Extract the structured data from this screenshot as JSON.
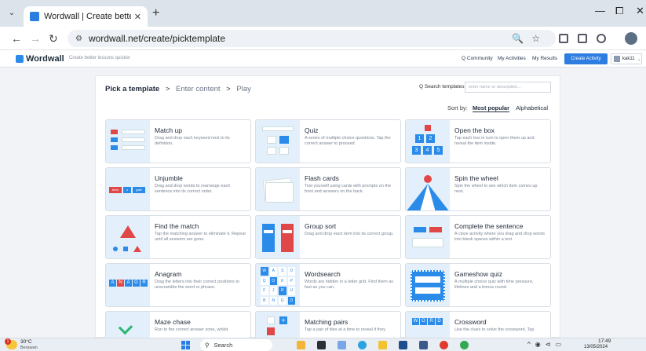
{
  "browser": {
    "tab_title": "Wordwall | Create better lessons quicker",
    "tab_close": "✕",
    "new_tab": "+",
    "url": "wordwall.net/create/picktemplate",
    "window_controls": [
      "—",
      "⧠",
      "✕"
    ]
  },
  "site": {
    "logo": "Wordwall",
    "tagline": "Create better lessons quicker",
    "nav": [
      "Community",
      "My Activities",
      "My Results"
    ],
    "create_button": "Create Activity",
    "user": "kak11"
  },
  "breadcrumb": {
    "step1": "Pick a template",
    "step2": "Enter content",
    "step3": "Play",
    "sep": ">"
  },
  "search": {
    "label": "Search templates:",
    "placeholder": "enter name or description..."
  },
  "sort": {
    "label": "Sort by:",
    "popular": "Most popular",
    "alphabetical": "Alphabetical"
  },
  "templates": [
    {
      "title": "Match up",
      "desc": "Drag and drop each keyword next to its definition."
    },
    {
      "title": "Quiz",
      "desc": "A series of multiple choice questions. Tap the correct answer to proceed."
    },
    {
      "title": "Open the box",
      "desc": "Tap each box in turn to open them up and reveal the item inside."
    },
    {
      "title": "Unjumble",
      "desc": "Drag and drop words to rearrange each sentence into its correct order."
    },
    {
      "title": "Flash cards",
      "desc": "Test yourself using cards with prompts on the front and answers on the back."
    },
    {
      "title": "Spin the wheel",
      "desc": "Spin the wheel to see which item comes up next."
    },
    {
      "title": "Find the match",
      "desc": "Tap the matching answer to eliminate it. Repeat until all answers are gone."
    },
    {
      "title": "Group sort",
      "desc": "Drag and drop each item into its correct group."
    },
    {
      "title": "Complete the sentence",
      "desc": "A cloze activity where you drag and drop words into blank spaces within a text."
    },
    {
      "title": "Anagram",
      "desc": "Drag the letters into their correct positions to unscramble the word or phrase."
    },
    {
      "title": "Wordsearch",
      "desc": "Words are hidden in a letter grid. Find them as fast as you can."
    },
    {
      "title": "Gameshow quiz",
      "desc": "A multiple choice quiz with time pressure, lifelines and a bonus round."
    },
    {
      "title": "Maze chase",
      "desc": "Run to the correct answer zone, whilst"
    },
    {
      "title": "Matching pairs",
      "desc": "Tap a pair of tiles at a time to reveal if they"
    },
    {
      "title": "Crossword",
      "desc": "Use the clues to solve the crossword. Tap"
    }
  ],
  "thumb_text": {
    "unjumble": [
      "beck",
      "o",
      "gale"
    ],
    "open_box": [
      "1",
      "2",
      "3",
      "4",
      "5"
    ],
    "wordsearch": [
      "W",
      "A",
      "S",
      "D",
      "Q",
      "O",
      "K",
      "P",
      "F",
      "J",
      "R",
      "U",
      "B",
      "N",
      "G",
      "D"
    ],
    "anagram": [
      "A",
      "N",
      "A",
      "G",
      "R"
    ],
    "crossword": [
      "W",
      "O",
      "R",
      "D"
    ]
  },
  "taskbar": {
    "temperature": "30°C",
    "weather": "Berawan",
    "weather_badge": "1",
    "search": "Search",
    "time": "17:49",
    "date": "13/05/2024"
  },
  "colors": {
    "accent": "#2e7de0",
    "thumb_bg": "#e3f0fb",
    "red": "#e04848",
    "blue": "#2b8be8"
  }
}
